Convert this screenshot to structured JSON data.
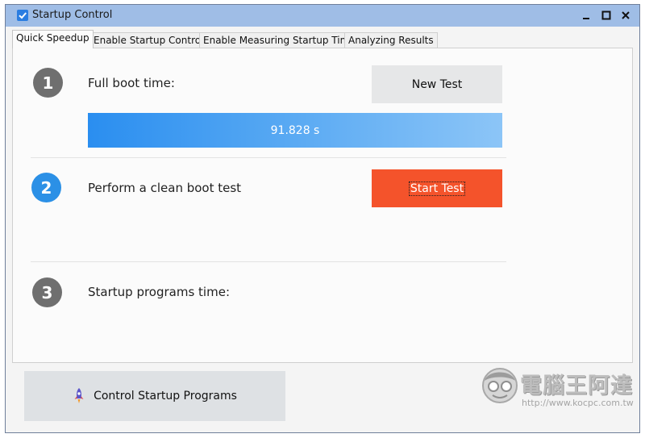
{
  "window": {
    "title": "Startup Control",
    "controls": {
      "minimize": "–",
      "maximize": "□",
      "close": "✕"
    }
  },
  "tabs": [
    {
      "label": "Quick Speedup",
      "active": true
    },
    {
      "label": "Enable Startup Control",
      "active": false
    },
    {
      "label": "Enable Measuring Startup Time",
      "active": false
    },
    {
      "label": "Analyzing Results",
      "active": false
    }
  ],
  "steps": [
    {
      "number": "1",
      "label": "Full boot time:",
      "color": "#6f6f6f"
    },
    {
      "number": "2",
      "label": "Perform a clean boot test",
      "color": "#2b90e6"
    },
    {
      "number": "3",
      "label": "Startup programs time:",
      "color": "#6f6f6f"
    }
  ],
  "buttons": {
    "new_test": "New Test",
    "start_test": "Start Test",
    "control_startup": "Control Startup Programs"
  },
  "progress": {
    "value_text": "91.828 s",
    "fraction": 1.0
  },
  "watermark": {
    "title": "電腦王阿達",
    "url": "http://www.kocpc.com.tw"
  },
  "colors": {
    "accent": "#2b90e6",
    "start_button": "#f4532b",
    "titlebar": "#9fbde6"
  },
  "icons": {
    "app": "checkbox-icon",
    "bottom_button": "rocket-icon"
  }
}
